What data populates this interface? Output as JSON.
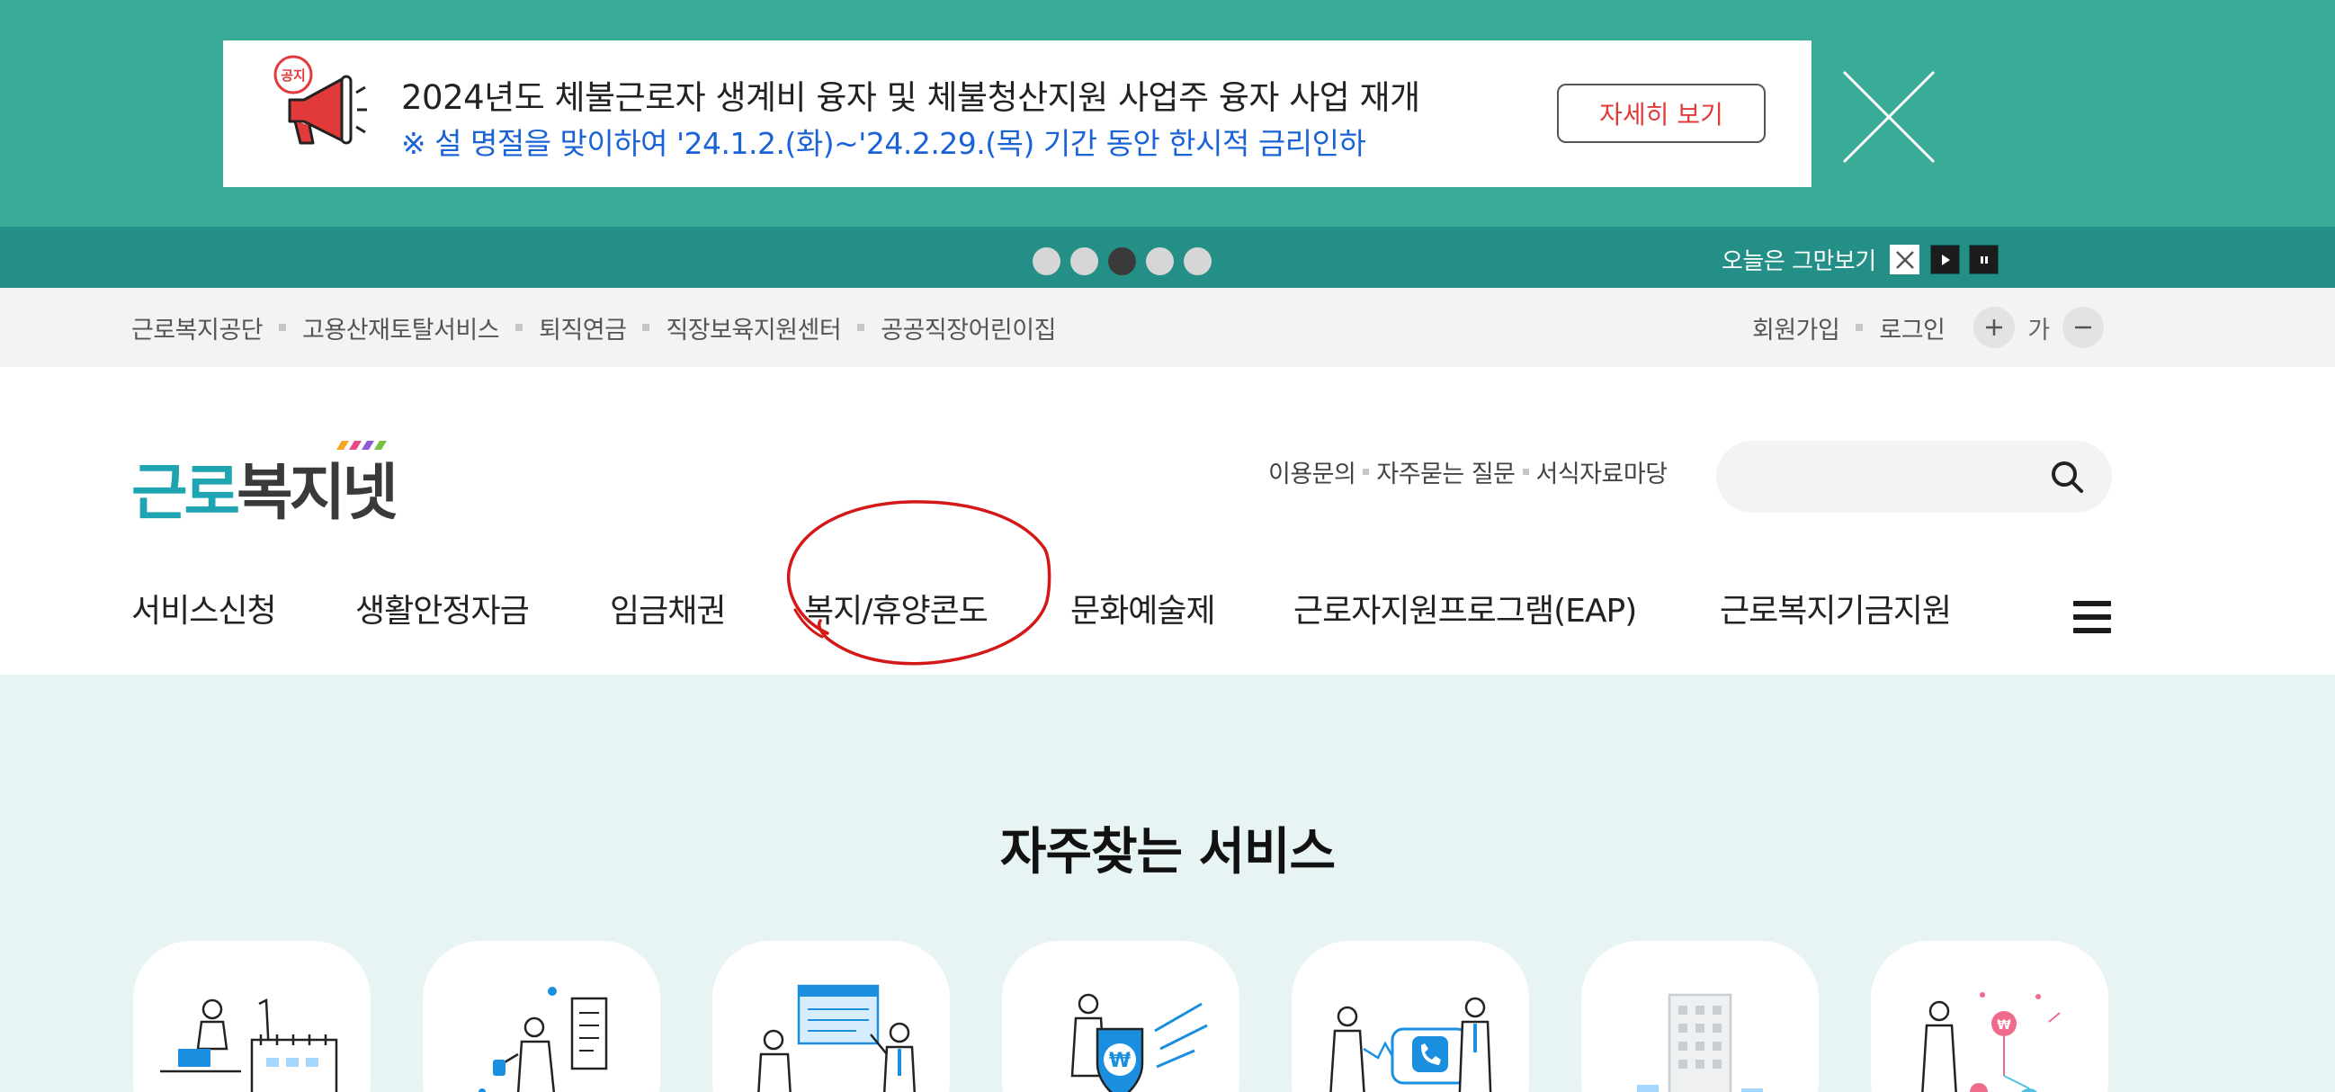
{
  "popup": {
    "badge": "공지",
    "line1": "2024년도 체불근로자 생계비 융자 및 체불청산지원 사업주 융자 사업 재개",
    "line2": "※ 설 명절을 맞이하여 '24.1.2.(화)~'24.2.29.(목) 기간 동안 한시적 금리인하",
    "detail_label": "자세히 보기",
    "slides": 5,
    "active_slide": 3,
    "today_close_label": "오늘은 그만보기"
  },
  "util": {
    "left_links": [
      "근로복지공단",
      "고용산재토탈서비스",
      "퇴직연금",
      "직장보육지원센터",
      "공공직장어린이집"
    ],
    "signup": "회원가입",
    "login": "로그인",
    "font_label": "가"
  },
  "header": {
    "logo_part1": "근로",
    "logo_part2": "복지넷",
    "quick_links": [
      "이용문의",
      "자주묻는 질문",
      "서식자료마당"
    ],
    "search_placeholder": ""
  },
  "gnb": {
    "items": [
      "서비스신청",
      "생활안정자금",
      "임금채권",
      "복지/휴양콘도",
      "문화예술제",
      "근로자지원프로그램(EAP)",
      "근로복지기금지원"
    ]
  },
  "main": {
    "section_title": "자주찾는 서비스"
  },
  "colors": {
    "popup_bg": "#3aab96",
    "ctrl_bg": "#248f86",
    "accent_blue": "#1a63d6",
    "accent_red": "#e23a3a",
    "logo_teal": "#1fa5b1",
    "main_bg": "#e7f4f3"
  },
  "icons": [
    "megaphone-icon",
    "close-icon",
    "play-icon",
    "pause-icon",
    "plus-icon",
    "minus-icon",
    "search-icon",
    "hamburger-menu-icon"
  ]
}
